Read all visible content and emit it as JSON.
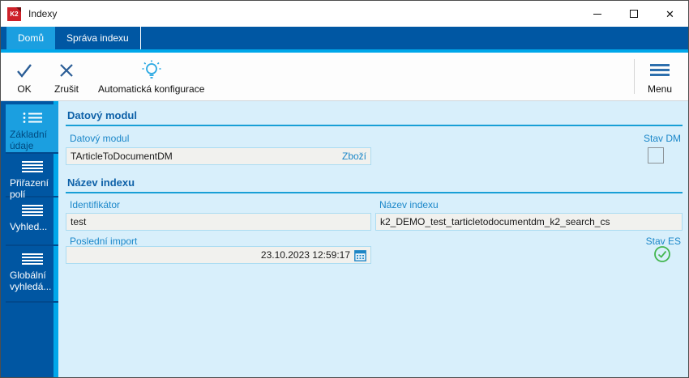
{
  "window": {
    "logo_text": "K2",
    "title": "Indexy"
  },
  "tabs": [
    {
      "label": "Domů",
      "active": true
    },
    {
      "label": "Správa indexu",
      "active": false
    }
  ],
  "toolbar": {
    "buttons": [
      {
        "label": "OK",
        "icon": "check-icon"
      },
      {
        "label": "Zrušit",
        "icon": "cancel-x-icon"
      },
      {
        "label": "Automatická konfigurace",
        "icon": "lightbulb-icon"
      }
    ],
    "menu_label": "Menu",
    "menu_icon": "hamburger-icon"
  },
  "sidebar": {
    "items": [
      {
        "label": "Základní údaje",
        "icon": "bullet-list-icon",
        "active": true
      },
      {
        "label": "Přiřazení polí",
        "icon": "list-lines-icon",
        "active": false
      },
      {
        "label": "Vyhled...",
        "icon": "list-lines-icon",
        "active": false
      },
      {
        "label": "Globální vyhledá...",
        "icon": "list-lines-icon",
        "active": false
      }
    ]
  },
  "content": {
    "section1_title": "Datový modul",
    "section2_title": "Název indexu",
    "fields": {
      "datovy_modul": {
        "label": "Datový modul",
        "value": "TArticleToDocumentDM",
        "link": "Zboží"
      },
      "stav_dm": {
        "label": "Stav DM",
        "checked": false
      },
      "identifikator": {
        "label": "Identifikátor",
        "value": "test"
      },
      "nazev_indexu": {
        "label": "Název indexu",
        "value": "k2_DEMO_test_tarticletodocumentdm_k2_search_cs"
      },
      "posledni_import": {
        "label": "Poslední import",
        "value": "23.10.2023 12:59:17",
        "icon": "calendar-icon"
      },
      "stav_es": {
        "label": "Stav ES",
        "status": "ok",
        "icon": "status-ok-icon"
      }
    }
  },
  "colors": {
    "dark_blue": "#0056a2",
    "active_blue": "#1b9fe0",
    "accent_cyan": "#00a7ea",
    "content_bg": "#d8effb",
    "label_blue": "#1b87c9",
    "section_blue": "#0e61a8",
    "status_green": "#42b64f",
    "logo_red": "#cd2129"
  }
}
